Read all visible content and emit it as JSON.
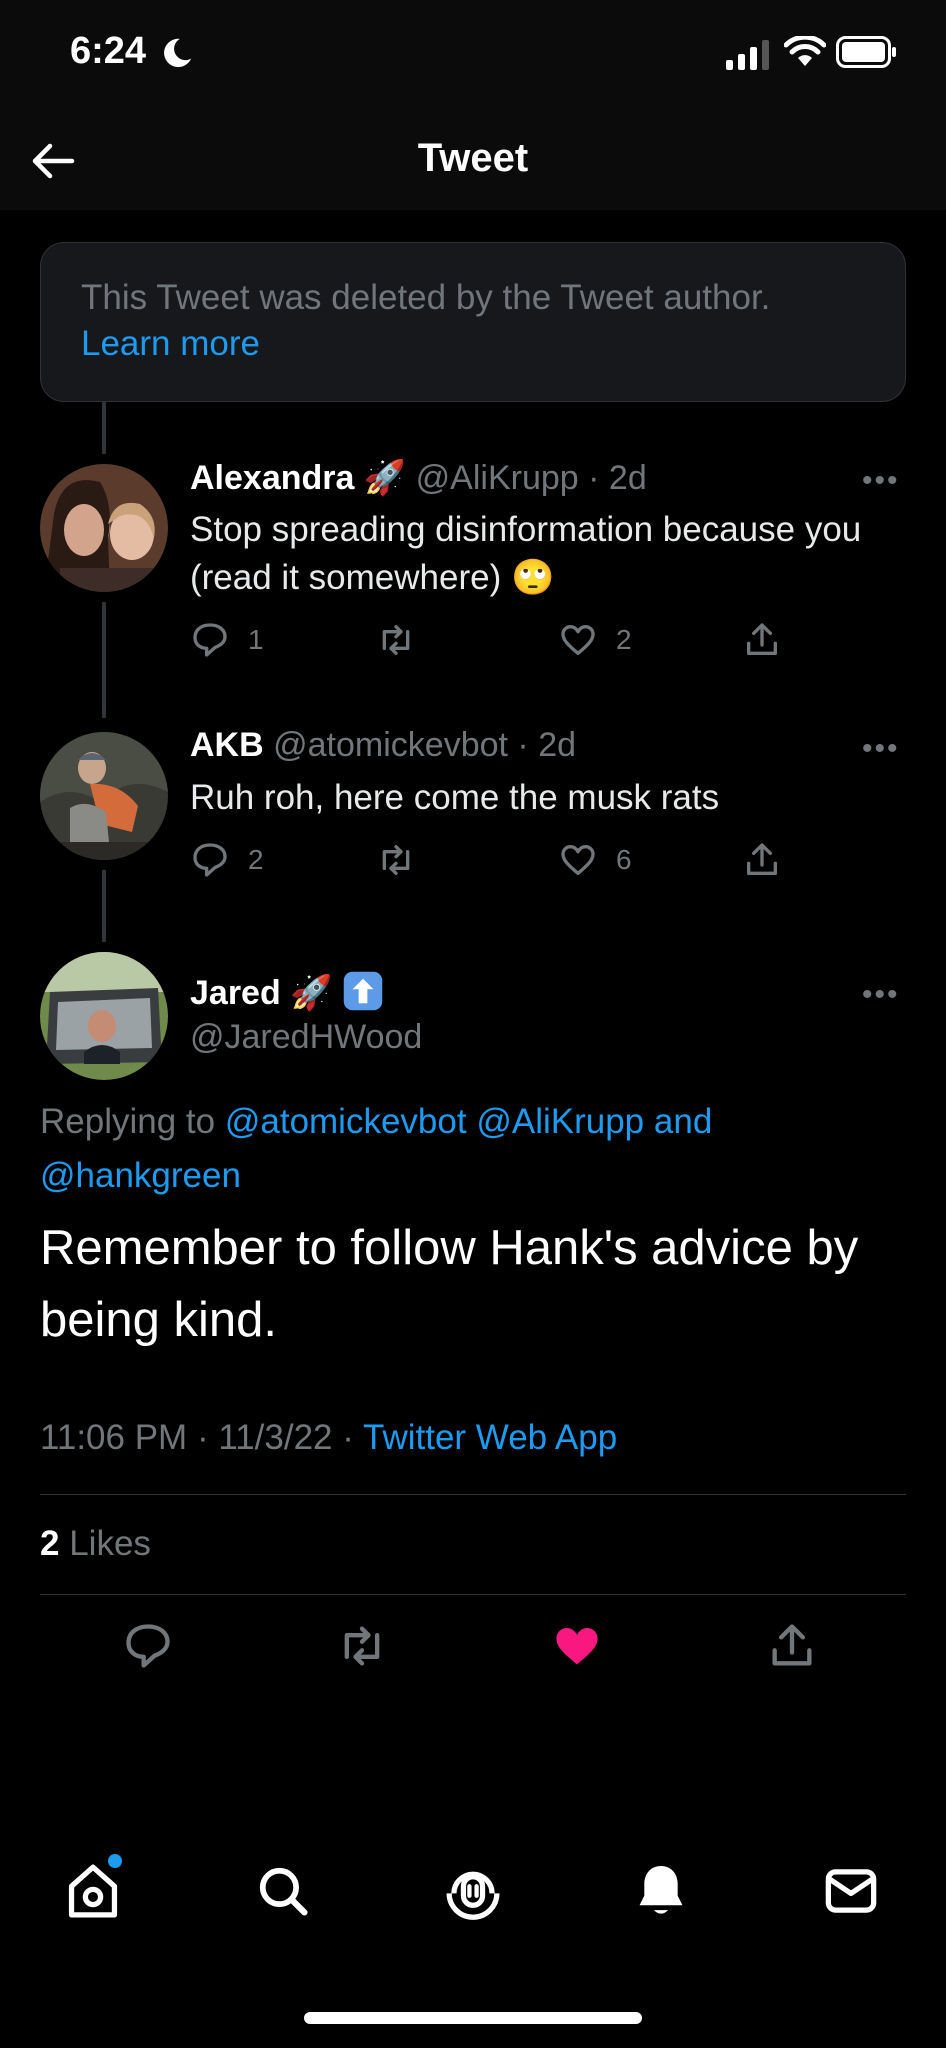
{
  "status_bar": {
    "time": "6:24"
  },
  "nav": {
    "title": "Tweet"
  },
  "deleted_notice": {
    "text": "This Tweet was deleted by the Tweet author.",
    "link": "Learn more"
  },
  "thread": [
    {
      "name": "Alexandra",
      "name_emoji": "🚀",
      "handle": "@AliKrupp",
      "time": "2d",
      "text": "Stop spreading disinformation because you (read it somewhere) 🙄",
      "reply_count": "1",
      "retweet_count": "",
      "like_count": "2"
    },
    {
      "name": "AKB",
      "name_emoji": "",
      "handle": "@atomickevbot",
      "time": "2d",
      "text": "Ruh roh, here come the musk rats",
      "reply_count": "2",
      "retweet_count": "",
      "like_count": "6"
    }
  ],
  "main_tweet": {
    "name": "Jared",
    "name_emoji": "🚀",
    "handle": "@JaredHWood",
    "replying_prefix": "Replying to",
    "replying_users": [
      "@atomickevbot",
      "@AliKrupp",
      "@hankgreen"
    ],
    "replying_and": "and",
    "text": "Remember to follow Hank's advice by being kind.",
    "time": "11:06 PM",
    "date": "11/3/22",
    "source": "Twitter Web App",
    "likes_count": "2",
    "likes_label": "Likes",
    "liked": true
  },
  "icons": {
    "back": "arrow-left-icon",
    "reply": "reply-icon",
    "retweet": "retweet-icon",
    "like": "heart-icon",
    "share": "share-icon",
    "more": "more-icon",
    "tabs": [
      "home-icon",
      "search-icon",
      "spaces-icon",
      "notifications-icon",
      "messages-icon"
    ]
  },
  "colors": {
    "accent": "#1d9bf0",
    "like": "#f91880",
    "background": "#000000",
    "muted": "#71767b"
  }
}
